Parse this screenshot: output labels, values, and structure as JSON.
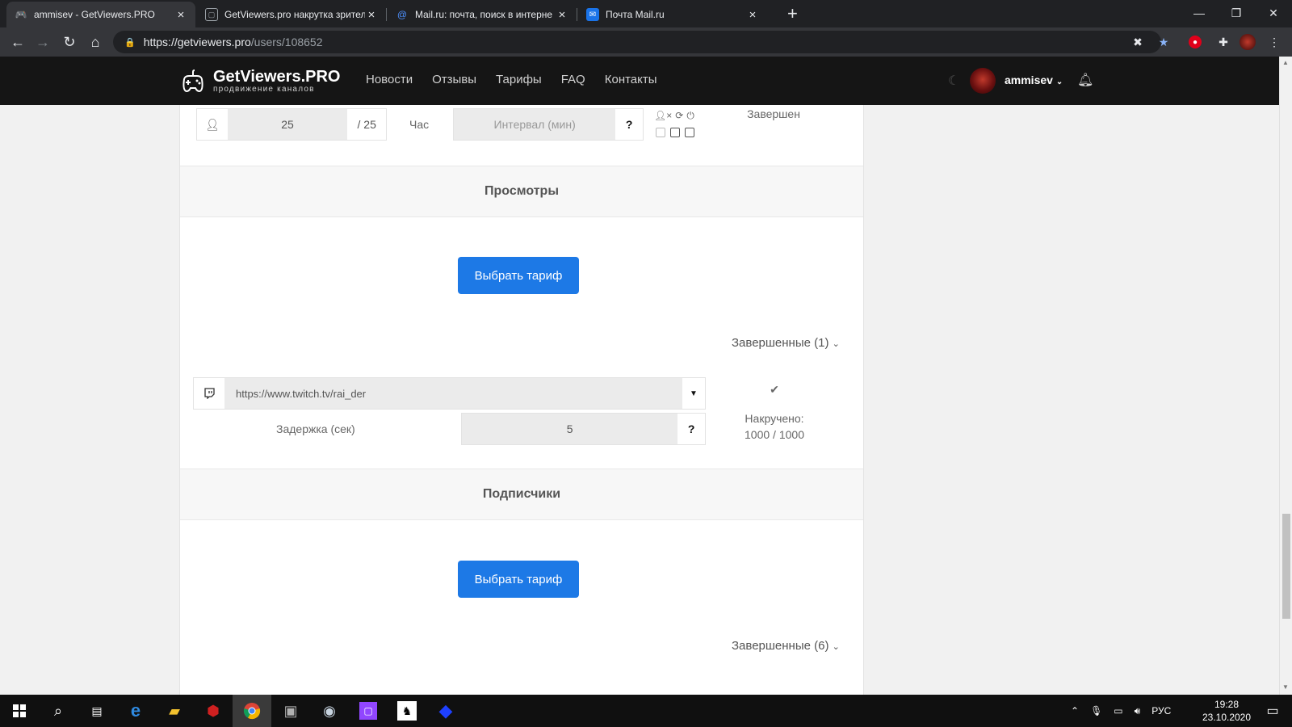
{
  "browser": {
    "tabs": [
      {
        "title": "ammisev - GetViewers.PRO",
        "favicon": "gamepad-icon",
        "active": true
      },
      {
        "title": "GetViewers.pro накрутка зрител",
        "favicon": "twitch-icon",
        "active": false
      },
      {
        "title": "Mail.ru: почта, поиск в интерне",
        "favicon": "at-icon",
        "active": false
      },
      {
        "title": "Почта Mail.ru",
        "favicon": "mail-icon",
        "active": false
      }
    ],
    "address": {
      "host": "https://getviewers.pro",
      "path": "/users/108652"
    }
  },
  "site": {
    "logo_title": "GetViewers.PRO",
    "logo_subtitle": "продвижение каналов",
    "nav": [
      "Новости",
      "Отзывы",
      "Тарифы",
      "FAQ",
      "Контакты"
    ],
    "username": "ammisev"
  },
  "top_row": {
    "count_value": "25",
    "count_max": "/ 25",
    "hour_label": "Час",
    "interval_placeholder": "Интервал (мин)",
    "help": "?",
    "status": "Завершен"
  },
  "views": {
    "title": "Просмотры",
    "choose_button": "Выбрать тариф",
    "completed_toggle": "Завершенные (1)",
    "url": "https://www.twitch.tv/rai_der",
    "delay_label": "Задержка (сек)",
    "delay_value": "5",
    "help": "?",
    "progress_label": "Накручено:",
    "progress_value": "1000 / 1000"
  },
  "followers": {
    "title": "Подписчики",
    "choose_button": "Выбрать тариф",
    "completed_toggle": "Завершенные (6)"
  },
  "taskbar": {
    "language": "РУС",
    "time": "19:28",
    "date": "23.10.2020"
  },
  "colors": {
    "primary_button": "#1d79e6",
    "header_bg": "#151515",
    "tab_bar_bg": "#202124"
  }
}
